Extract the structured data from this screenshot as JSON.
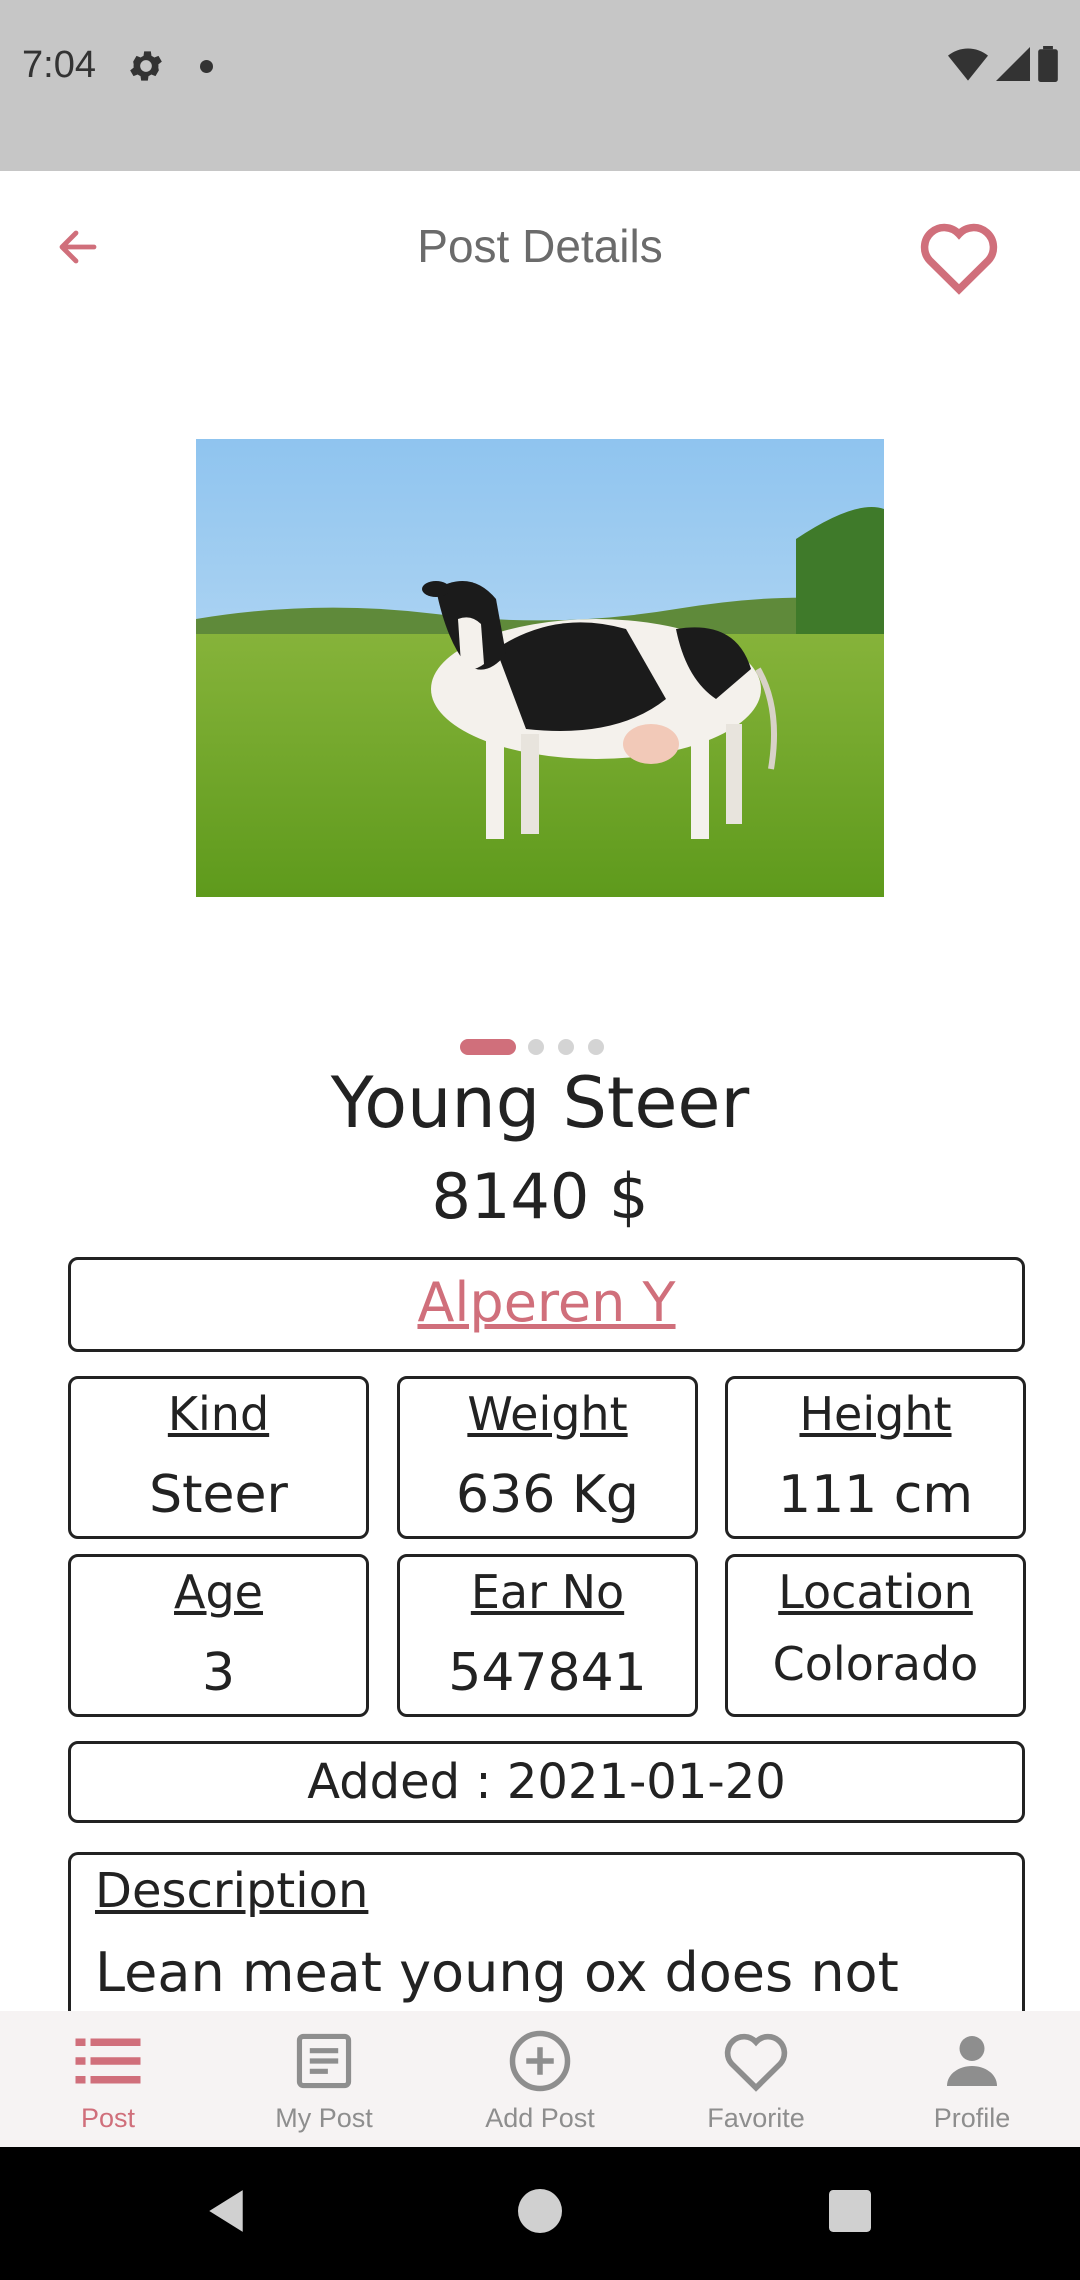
{
  "status_bar": {
    "time": "7:04",
    "icons": [
      "gear-icon",
      "notification-dot-icon",
      "wifi-icon",
      "signal-icon",
      "battery-icon"
    ]
  },
  "header": {
    "title": "Post Details",
    "back_icon": "arrow-left-icon",
    "favorite_icon": "heart-outline-icon"
  },
  "gallery": {
    "image_description": "black and white cow standing in green pasture",
    "page_count": 4,
    "active_page": 1
  },
  "post": {
    "title": "Young Steer",
    "price": "8140 $",
    "owner": "Alperen Y",
    "stats": [
      {
        "label": "Kind",
        "value": "Steer"
      },
      {
        "label": "Weight",
        "value": "636 Kg"
      },
      {
        "label": "Height",
        "value": "111 cm"
      },
      {
        "label": "Age",
        "value": "3"
      },
      {
        "label": "Ear No",
        "value": "547841"
      },
      {
        "label": "Location",
        "value": "Colorado"
      }
    ],
    "added": "Added : 2021-01-20",
    "description_label": "Description",
    "description_text": "Lean meat young ox does not"
  },
  "bottom_nav": {
    "items": [
      {
        "label": "Post",
        "icon": "list-icon",
        "active": true
      },
      {
        "label": "My Post",
        "icon": "document-icon",
        "active": false
      },
      {
        "label": "Add Post",
        "icon": "add-circle-icon",
        "active": false
      },
      {
        "label": "Favorite",
        "icon": "heart-icon",
        "active": false
      },
      {
        "label": "Profile",
        "icon": "person-icon",
        "active": false
      }
    ]
  },
  "colors": {
    "accent": "#d06f7b",
    "status_bar": "#c6c6c6",
    "nav_background": "#f6f3f3",
    "text": "#222222",
    "muted": "#8e8e8e"
  }
}
